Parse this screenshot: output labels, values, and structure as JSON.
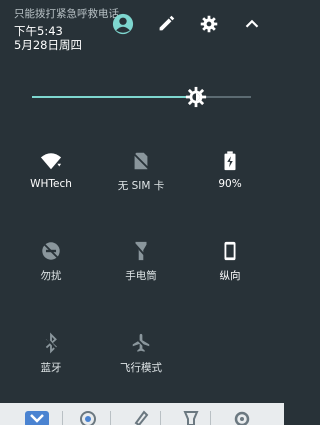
{
  "status": {
    "emergency_note": "只能拨打紧急呼救电话",
    "time": "下午5:43",
    "date": "5月28日周四"
  },
  "header_icons": [
    "account-icon",
    "edit-icon",
    "settings-icon",
    "collapse-icon"
  ],
  "brightness": {
    "level": 0.75,
    "accent_color": "#7ed6cf"
  },
  "tiles": [
    {
      "label": "WHTech",
      "icon": "wifi-icon",
      "active": true
    },
    {
      "label": "无 SIM 卡",
      "icon": "no-sim-icon",
      "active": false
    },
    {
      "label": "90%",
      "icon": "battery-charging-icon",
      "active": true
    },
    {
      "label": "勿扰",
      "icon": "do-not-disturb-icon",
      "active": false
    },
    {
      "label": "手电筒",
      "icon": "flashlight-icon",
      "active": false
    },
    {
      "label": "纵向",
      "icon": "portrait-icon",
      "active": true
    },
    {
      "label": "蓝牙",
      "icon": "bluetooth-icon",
      "active": false
    },
    {
      "label": "飞行模式",
      "icon": "airplane-icon",
      "active": false
    }
  ],
  "bottom_bar_icons": [
    "app-icon-1",
    "app-icon-2",
    "app-icon-3",
    "app-icon-4",
    "app-icon-5"
  ],
  "colors": {
    "background": "#283238",
    "accent": "#7ed6cf",
    "icon_inactive": "#8a969c"
  }
}
